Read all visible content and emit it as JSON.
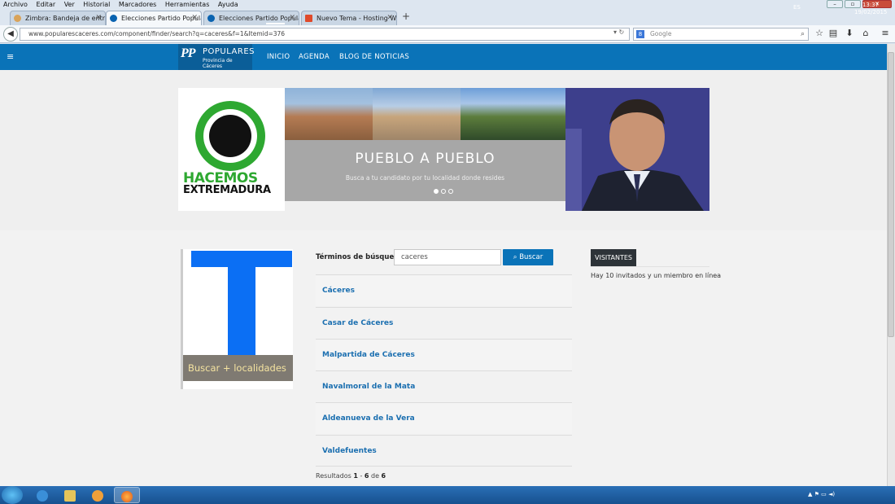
{
  "browser": {
    "menu": [
      "Archivo",
      "Editar",
      "Ver",
      "Historial",
      "Marcadores",
      "Herramientas",
      "Ayuda"
    ],
    "tabs": [
      {
        "label": "Zimbra: Bandeja de entrad..."
      },
      {
        "label": "Elecciones Partido Popular ..."
      },
      {
        "label": "Elecciones Partido Popular ..."
      },
      {
        "label": "Nuevo Tema - Hosting Wo..."
      }
    ],
    "url": "www.popularescaceres.com/component/finder/search?q=caceres&f=1&Itemid=376",
    "search_placeholder": "Google"
  },
  "site": {
    "logo_mark": "PP",
    "logo_title": "POPULARES",
    "logo_subtitle": "Provincia de Cáceres",
    "nav": [
      "INICIO",
      "AGENDA",
      "BLOG DE NOTICIAS"
    ]
  },
  "banner": {
    "logo_line1": "HACEMOS",
    "logo_line2": "EXTREMADURA",
    "slide_title": "PUEBLO A PUEBLO",
    "slide_subtitle": "Busca a tu candidato por tu localidad donde resides"
  },
  "left_widget": {
    "label": "Buscar + localidades"
  },
  "search": {
    "label": "Términos de búsqueda:",
    "value": "caceres",
    "button_label": "Buscar"
  },
  "results": [
    "Cáceres",
    "Casar de Cáceres",
    "Malpartida de Cáceres",
    "Navalmoral de la Mata",
    "Aldeanueva de la Vera",
    "Valdefuentes"
  ],
  "pagination": {
    "prefix": "Resultados",
    "from": "1",
    "sep": "-",
    "to": "6",
    "of": "de",
    "total": "6"
  },
  "visitors": {
    "title": "VISITANTES",
    "text": "Hay 10 invitados y un miembro en línea"
  },
  "taskbar": {
    "lang": "ES",
    "time": "13:37",
    "date": "19/02/2015"
  },
  "colors": {
    "brand_blue": "#0a73b8",
    "link_blue": "#1b6fb0",
    "green": "#2ea831"
  }
}
